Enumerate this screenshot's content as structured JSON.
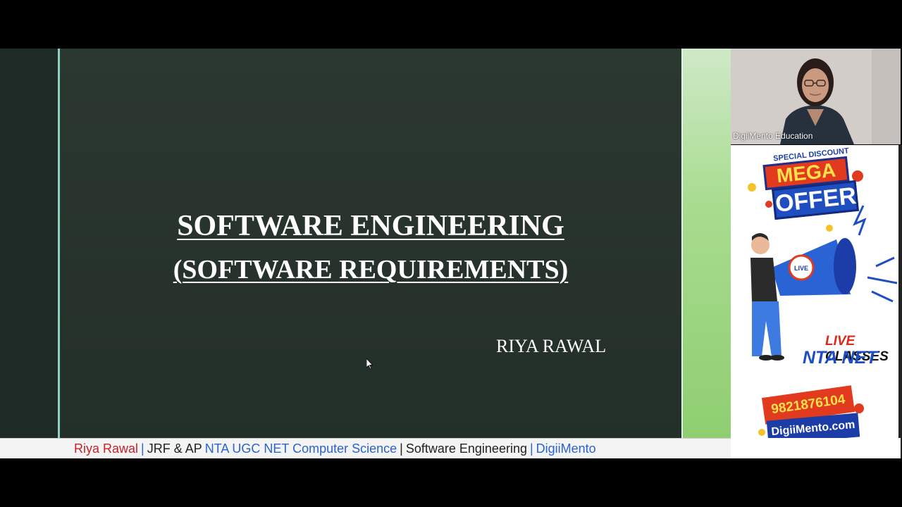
{
  "slide": {
    "title_line1": "SOFTWARE ENGINEERING",
    "title_line2": "(SOFTWARE REQUIREMENTS)",
    "author": "RIYA RAWAL"
  },
  "webcam": {
    "name": "DigiiMento Education"
  },
  "ad": {
    "special_discount": "SPECIAL DISCOUNT",
    "mega": "MEGA",
    "offer": "OFFER",
    "megaphone_badge": "LIVE",
    "live": "LIVE",
    "classes": "CLASSES",
    "nta_net": "NTA NET",
    "phone": "9821876104",
    "website": "DigiiMento.com"
  },
  "ticker": {
    "name": "Riya Rawal",
    "sep1": "|",
    "role": "JRF & AP",
    "exam": "NTA UGC NET Computer Science",
    "sep2": "|",
    "subject": "Software Engineering",
    "sep3": "|",
    "brand": "DigiiMento"
  },
  "colors": {
    "slide_bg": "#26322b",
    "accent_teal": "#8fd0c0",
    "ticker_red": "#c8202a",
    "ticker_blue": "#2a63d4",
    "ad_red": "#e23a1e",
    "ad_blue": "#1f4ec0"
  }
}
